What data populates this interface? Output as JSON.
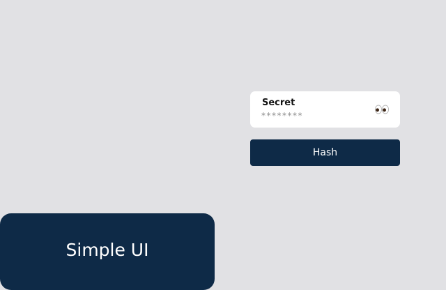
{
  "secret_field": {
    "label": "Secret",
    "value": "********",
    "reveal_icon": "eyes-icon"
  },
  "hash_button": {
    "label": "Hash"
  },
  "brand": {
    "title": "Simple UI"
  },
  "colors": {
    "background": "#e1e1e4",
    "navy": "#0e2a47",
    "card": "#ffffff"
  }
}
